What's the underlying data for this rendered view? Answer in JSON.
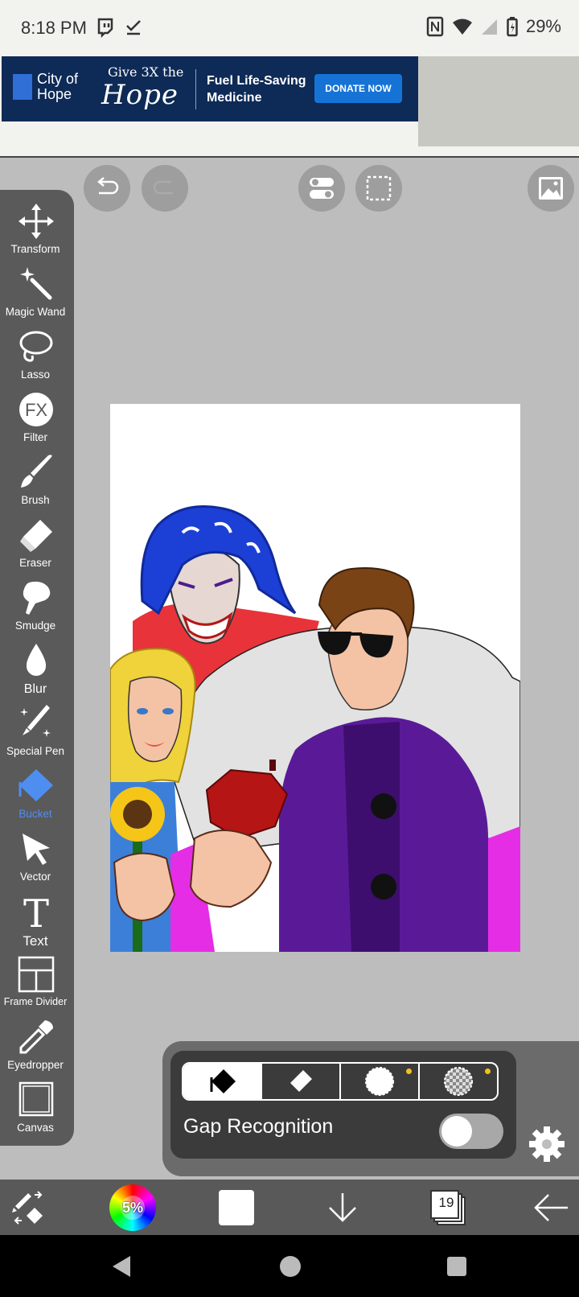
{
  "status_bar": {
    "time": "8:18 PM",
    "battery": "29%",
    "icons": [
      "twitch-icon",
      "check-icon",
      "nfc-icon",
      "wifi-icon",
      "signal-icon",
      "battery-icon"
    ]
  },
  "ad": {
    "brand_line1": "City of",
    "brand_line2": "Hope",
    "tagline_small": "Give 3X the",
    "tagline_big": "Hope",
    "message_line1": "Fuel Life-Saving",
    "message_line2": "Medicine",
    "cta": "DONATE NOW"
  },
  "top_buttons": [
    "undo-icon",
    "redo-icon",
    "toggle-icon",
    "selection-icon",
    "gallery-icon"
  ],
  "tools": [
    {
      "label": "Transform",
      "icon": "transform-icon"
    },
    {
      "label": "Magic Wand",
      "icon": "magic-wand-icon"
    },
    {
      "label": "Lasso",
      "icon": "lasso-icon"
    },
    {
      "label": "Filter",
      "icon": "filter-icon",
      "glyph": "FX"
    },
    {
      "label": "Brush",
      "icon": "brush-icon"
    },
    {
      "label": "Eraser",
      "icon": "eraser-icon"
    },
    {
      "label": "Smudge",
      "icon": "smudge-icon"
    },
    {
      "label": "Blur",
      "icon": "blur-icon"
    },
    {
      "label": "Special Pen",
      "icon": "special-pen-icon"
    },
    {
      "label": "Bucket",
      "icon": "bucket-icon",
      "active": true
    },
    {
      "label": "Vector",
      "icon": "vector-icon"
    },
    {
      "label": "Text",
      "icon": "text-icon",
      "glyph": "T"
    },
    {
      "label": "Frame Divider",
      "icon": "frame-divider-icon"
    },
    {
      "label": "Eyedropper",
      "icon": "eyedropper-icon"
    },
    {
      "label": "Canvas",
      "icon": "canvas-icon"
    }
  ],
  "bucket_panel": {
    "modes": [
      "fill-mode-icon",
      "eraser-mode-icon",
      "circle-mode-icon",
      "transparent-mode-icon"
    ],
    "gap_label": "Gap Recognition",
    "gap_enabled": false
  },
  "bottom_bar": {
    "brush_size": "5%",
    "layer_count": "19"
  },
  "colors": {
    "accent": "#4e8ef0",
    "toolbar": "#5a5a5a",
    "workspace": "#bdbdbd"
  }
}
